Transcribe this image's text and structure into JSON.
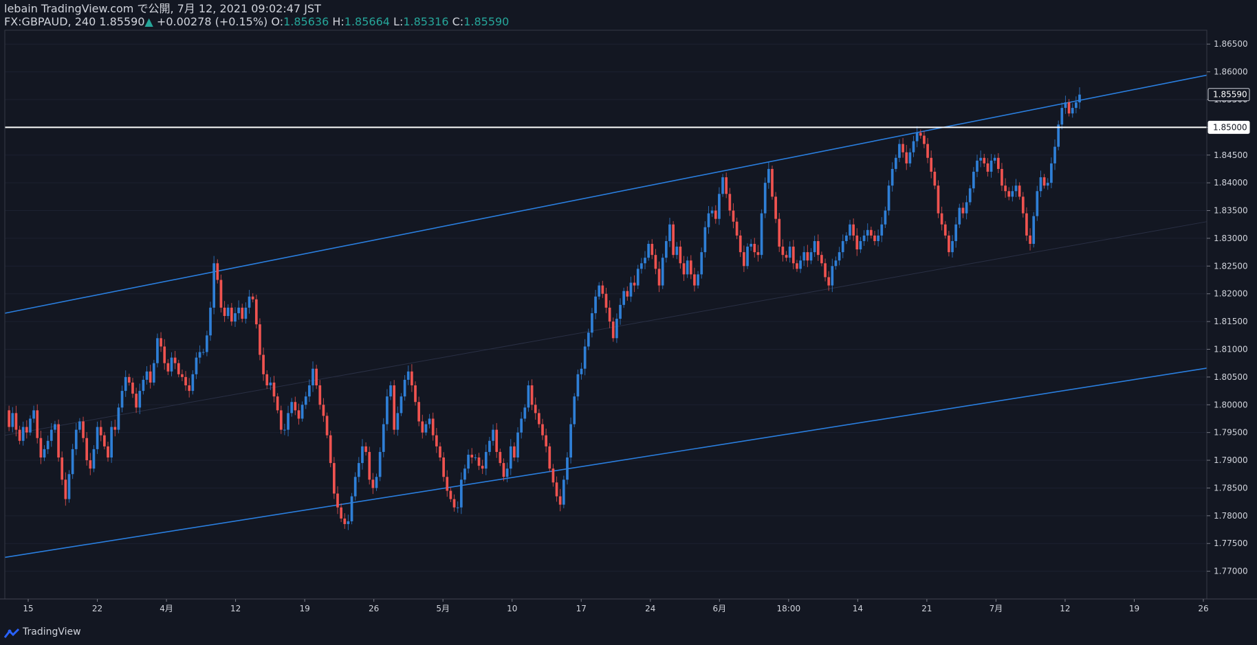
{
  "header": {
    "publish_line": "lebain TradingView.com で公開, 7月 12, 2021 09:02:47 JST",
    "symbol": "FX:GBPAUD, 240",
    "last": "1.85590",
    "change_arrow": "▲",
    "change": "+0.00278 (+0.15%)",
    "o_label": "O:",
    "o_value": "1.85636",
    "h_label": "H:",
    "h_value": "1.85664",
    "l_label": "L:",
    "l_value": "1.85316",
    "c_label": "C:",
    "c_value": "1.85590"
  },
  "footer": {
    "brand": "TradingView",
    "brand_icon": "tradingview-logo-icon"
  },
  "colors": {
    "background": "#131722",
    "bull": "#2f7fd6",
    "bear": "#ef5350",
    "channel": "#2a7fe0",
    "level": "#ffffff",
    "text": "#d1d4dc",
    "accent": "#26a69a"
  },
  "chart_data": {
    "type": "candlestick",
    "symbol": "FX:GBPAUD",
    "interval": "240",
    "ylim": [
      1.765,
      1.8675
    ],
    "y_ticks": [
      "1.86500",
      "1.86000",
      "1.85500",
      "1.85000",
      "1.84500",
      "1.84000",
      "1.83500",
      "1.83000",
      "1.82500",
      "1.82000",
      "1.81500",
      "1.81000",
      "1.80500",
      "1.80000",
      "1.79500",
      "1.79000",
      "1.78500",
      "1.78000",
      "1.77500",
      "1.77000"
    ],
    "x_ticks": [
      "15",
      "22",
      "4月",
      "12",
      "19",
      "26",
      "5月",
      "10",
      "17",
      "24",
      "6月",
      "18:00",
      "14",
      "21",
      "7月",
      "12",
      "19",
      "26"
    ],
    "price_labels": [
      {
        "text": "1.85590",
        "value": 1.8559,
        "style": "last"
      },
      {
        "text": "1.85000",
        "value": 1.85,
        "style": "level"
      }
    ],
    "horizontal_level": 1.85,
    "channel": {
      "upper_start": 1.8165,
      "upper_end": 1.8594,
      "lower_start": 1.7725,
      "lower_end": 1.8066,
      "mid_start": 1.7945,
      "mid_end": 1.833
    },
    "path": [
      1.799,
      1.796,
      1.7985,
      1.7955,
      1.7935,
      1.796,
      1.795,
      1.7975,
      1.799,
      1.794,
      1.7905,
      1.792,
      1.7935,
      1.7955,
      1.7965,
      1.7905,
      1.7865,
      1.783,
      1.7875,
      1.792,
      1.7955,
      1.797,
      1.794,
      1.79,
      1.7885,
      1.792,
      1.796,
      1.7945,
      1.7925,
      1.7905,
      1.796,
      1.7955,
      1.7995,
      1.8025,
      1.805,
      1.804,
      1.802,
      1.7995,
      1.8025,
      1.8045,
      1.806,
      1.804,
      1.8075,
      1.812,
      1.8105,
      1.8075,
      1.806,
      1.8085,
      1.8075,
      1.8055,
      1.805,
      1.8035,
      1.8025,
      1.8055,
      1.8085,
      1.8095,
      1.8095,
      1.8125,
      1.8175,
      1.8255,
      1.8225,
      1.8175,
      1.816,
      1.8175,
      1.815,
      1.8165,
      1.8175,
      1.8155,
      1.8175,
      1.8195,
      1.819,
      1.8145,
      1.809,
      1.8055,
      1.8035,
      1.804,
      1.8015,
      1.799,
      1.7955,
      1.7955,
      1.7985,
      1.8005,
      1.799,
      1.7975,
      1.8,
      1.8015,
      1.8035,
      1.8065,
      1.8035,
      1.8,
      1.798,
      1.7945,
      1.7895,
      1.784,
      1.7815,
      1.7795,
      1.7785,
      1.779,
      1.7835,
      1.787,
      1.7895,
      1.7925,
      1.7915,
      1.7865,
      1.785,
      1.787,
      1.7915,
      1.7965,
      1.8015,
      1.8035,
      1.7955,
      1.7985,
      1.8015,
      1.8045,
      1.806,
      1.8035,
      1.8005,
      1.797,
      1.795,
      1.7965,
      1.7975,
      1.7945,
      1.7925,
      1.7905,
      1.787,
      1.7845,
      1.783,
      1.7815,
      1.7815,
      1.7865,
      1.7885,
      1.791,
      1.7905,
      1.7905,
      1.789,
      1.7885,
      1.7915,
      1.7935,
      1.7955,
      1.7915,
      1.7895,
      1.787,
      1.7885,
      1.7925,
      1.7905,
      1.795,
      1.7975,
      1.7995,
      1.8035,
      1.8,
      1.7985,
      1.7965,
      1.7945,
      1.7925,
      1.7885,
      1.786,
      1.7835,
      1.782,
      1.7865,
      1.7905,
      1.7965,
      1.8015,
      1.8055,
      1.8065,
      1.8105,
      1.813,
      1.8165,
      1.8195,
      1.8215,
      1.82,
      1.8175,
      1.815,
      1.812,
      1.8155,
      1.818,
      1.8205,
      1.8195,
      1.822,
      1.8215,
      1.8245,
      1.8255,
      1.8265,
      1.829,
      1.827,
      1.8245,
      1.8215,
      1.8265,
      1.8295,
      1.8325,
      1.827,
      1.8285,
      1.8255,
      1.8235,
      1.826,
      1.8235,
      1.8215,
      1.8235,
      1.8275,
      1.832,
      1.8345,
      1.835,
      1.8335,
      1.838,
      1.841,
      1.838,
      1.835,
      1.833,
      1.8305,
      1.8275,
      1.825,
      1.8285,
      1.829,
      1.8275,
      1.827,
      1.8345,
      1.84,
      1.8425,
      1.8375,
      1.8335,
      1.8285,
      1.827,
      1.8265,
      1.8285,
      1.8255,
      1.8245,
      1.826,
      1.8275,
      1.826,
      1.8275,
      1.8295,
      1.827,
      1.8255,
      1.823,
      1.8215,
      1.825,
      1.826,
      1.8275,
      1.8295,
      1.8305,
      1.8325,
      1.8305,
      1.828,
      1.8295,
      1.8305,
      1.8315,
      1.8305,
      1.8295,
      1.8305,
      1.8325,
      1.835,
      1.8395,
      1.8425,
      1.8445,
      1.847,
      1.8455,
      1.8435,
      1.8455,
      1.8475,
      1.849,
      1.8485,
      1.847,
      1.8445,
      1.842,
      1.8395,
      1.8345,
      1.8325,
      1.8305,
      1.8275,
      1.8295,
      1.8325,
      1.8355,
      1.8345,
      1.8365,
      1.839,
      1.842,
      1.844,
      1.8445,
      1.8435,
      1.842,
      1.844,
      1.8445,
      1.8425,
      1.8395,
      1.8385,
      1.8375,
      1.8385,
      1.8395,
      1.8375,
      1.8345,
      1.8305,
      1.829,
      1.834,
      1.8385,
      1.841,
      1.8395,
      1.84,
      1.8435,
      1.8465,
      1.8505,
      1.8535,
      1.8545,
      1.8525,
      1.8535,
      1.8545,
      1.8559
    ]
  }
}
